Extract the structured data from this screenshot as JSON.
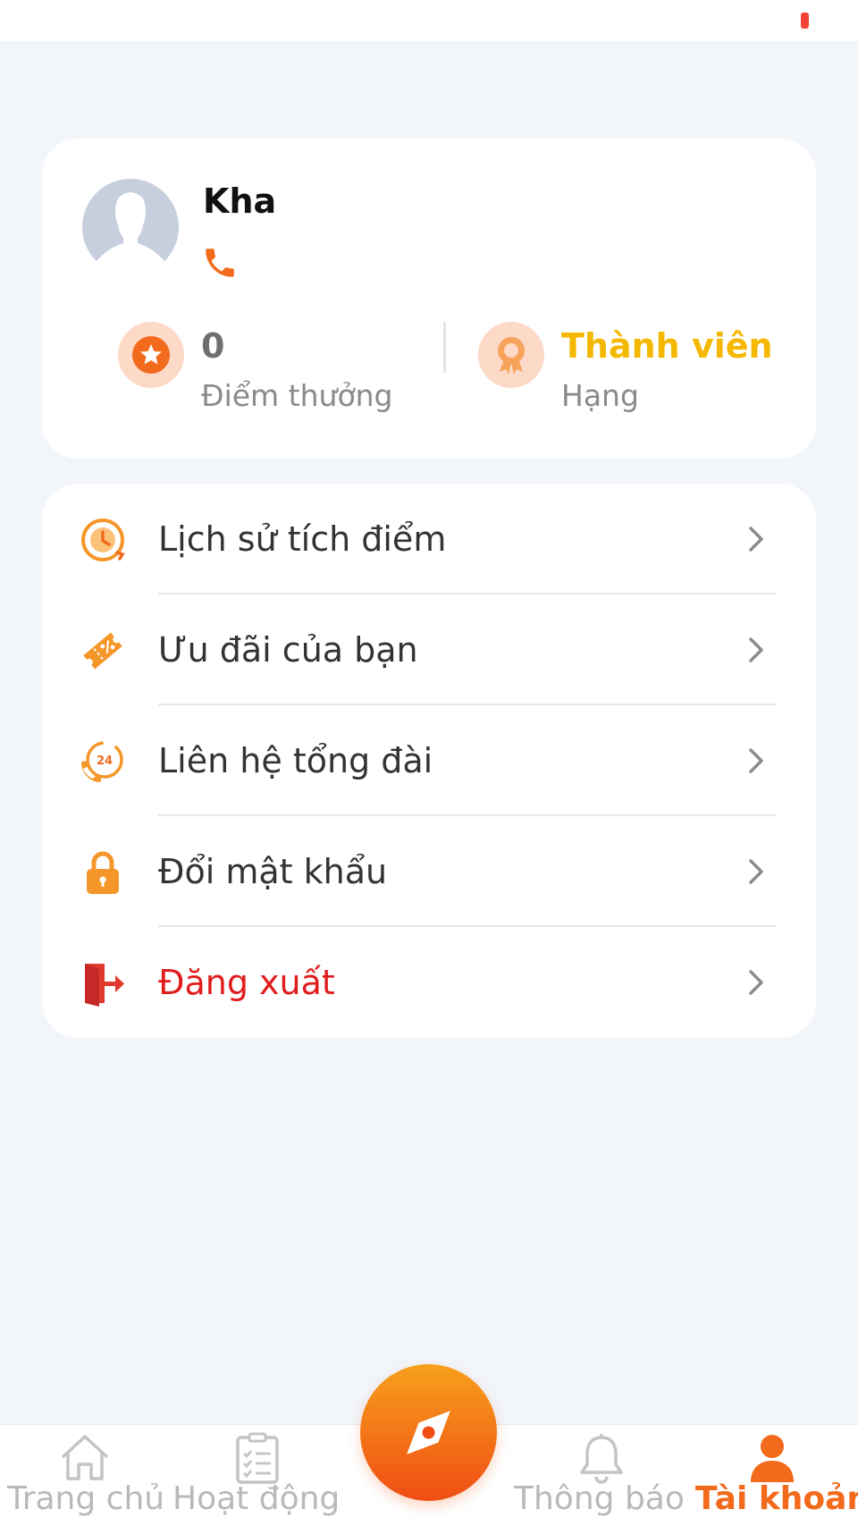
{
  "profile": {
    "name": "Kha",
    "points_value": "0",
    "points_label": "Điểm thưởng",
    "rank_value": "Thành viên",
    "rank_label": "Hạng"
  },
  "menu": {
    "items": [
      {
        "label": "Lịch sử tích điểm",
        "icon": "history-clock-icon"
      },
      {
        "label": "Ưu đãi của bạn",
        "icon": "voucher-ticket-icon"
      },
      {
        "label": "Liên hệ tổng đài",
        "icon": "support-24-icon"
      },
      {
        "label": "Đổi mật khẩu",
        "icon": "lock-icon"
      },
      {
        "label": "Đăng xuất",
        "icon": "logout-door-icon"
      }
    ]
  },
  "bottom_nav": {
    "home": "Trang chủ",
    "activity": "Hoạt động",
    "notifications": "Thông báo",
    "account": "Tài khoản",
    "active": "account"
  },
  "colors": {
    "accent": "#f26a1b",
    "rank": "#f5b800",
    "danger": "#e01c1c",
    "background": "#f2f5fa"
  }
}
